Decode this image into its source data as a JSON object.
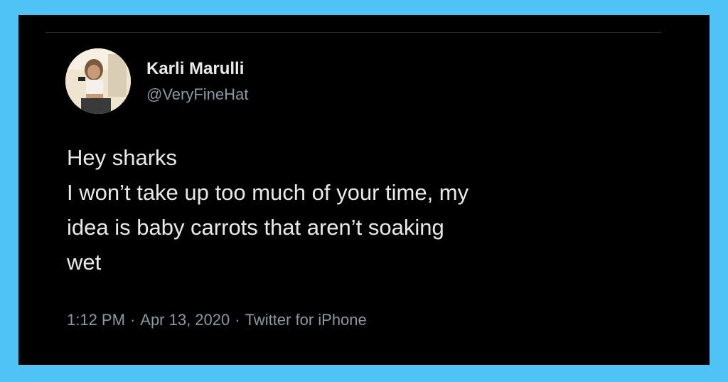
{
  "colors": {
    "frame": "#4fc3f7",
    "card_background": "#000000",
    "primary_text": "#e7e9ea",
    "secondary_text": "#8b98a5"
  },
  "user": {
    "display_name": "Karli Marulli",
    "handle": "@VeryFineHat",
    "avatar_icon": "profile-photo"
  },
  "tweet": {
    "lines": [
      "Hey sharks",
      "I won’t take up too much of your time, my",
      "idea is baby carrots that aren’t soaking",
      "wet"
    ],
    "time": "1:12 PM",
    "separator": "·",
    "date": "Apr 13, 2020",
    "source": "Twitter for iPhone"
  }
}
